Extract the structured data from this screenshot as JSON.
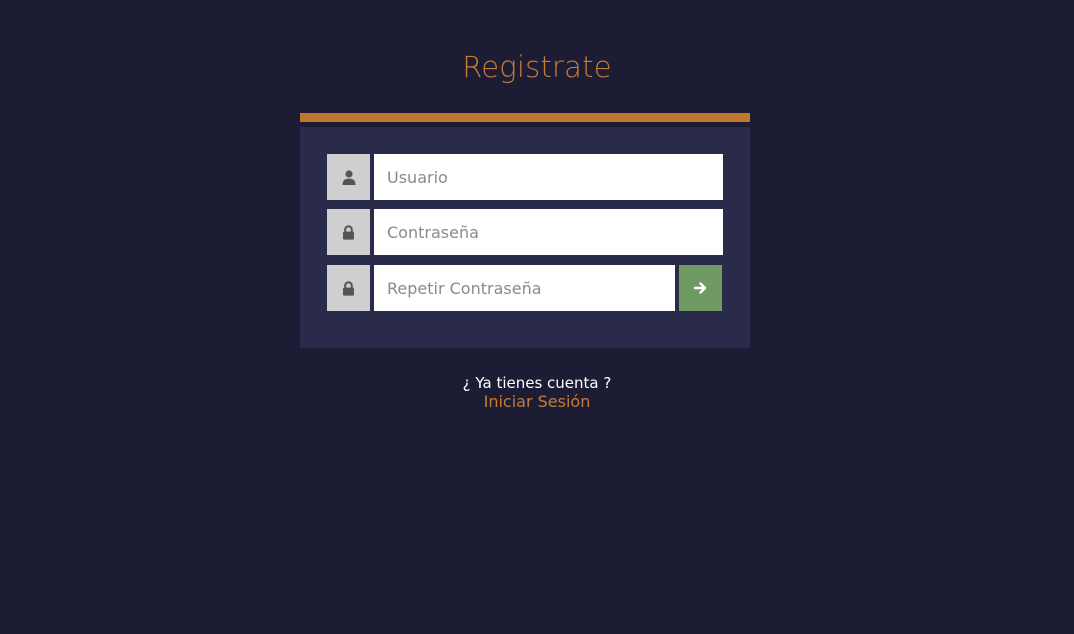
{
  "page": {
    "title": "Registrate"
  },
  "form": {
    "fields": [
      {
        "icon": "user-icon",
        "placeholder": "Usuario",
        "value": ""
      },
      {
        "icon": "lock-icon",
        "placeholder": "Contraseña",
        "value": ""
      },
      {
        "icon": "lock-icon",
        "placeholder": "Repetir Contraseña",
        "value": ""
      }
    ],
    "submit_icon": "arrow-right-icon"
  },
  "footer": {
    "question": "¿ Ya tienes cuenta ?",
    "link_label": "Iniciar Sesión"
  },
  "colors": {
    "background": "#1c1d35",
    "panel": "#2a2b4a",
    "accent": "#c0782c",
    "submit": "#6f9a63",
    "icon_box": "#cfcfcf"
  }
}
